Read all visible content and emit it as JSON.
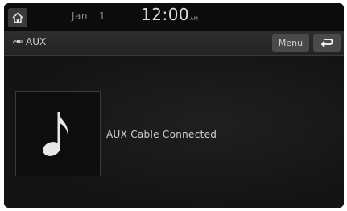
{
  "status_bar": {
    "month": "Jan",
    "day": "1",
    "time": "12:00",
    "time_suffix": "AM"
  },
  "header": {
    "title": "AUX",
    "menu_label": "Menu"
  },
  "main": {
    "status_message": "AUX Cable Connected"
  },
  "icons": {
    "home": "home-icon",
    "aux": "aux-plug-icon",
    "back": "back-arrow-icon",
    "music": "music-note-icon"
  },
  "colors": {
    "screen_background": "#151515",
    "text_primary": "#d0d0d0",
    "button_background": "#4a4a4a"
  }
}
